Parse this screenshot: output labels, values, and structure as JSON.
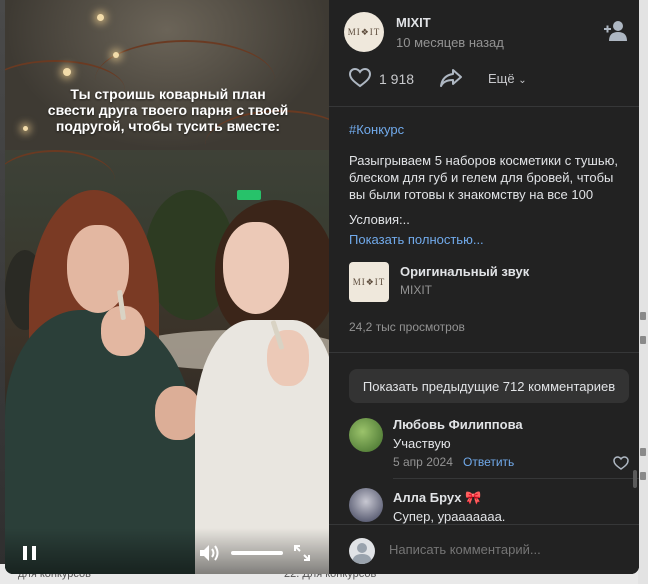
{
  "video": {
    "caption": "Ты строишь коварный план\nсвести друга твоего парня с твоей\nподругой, чтобы тусить вместе:",
    "icons": {
      "pause": "pause-icon",
      "volume": "volume-icon",
      "fullscreen": "fullscreen-icon"
    },
    "volume_level": 1.0
  },
  "post": {
    "author": "MIXIT",
    "logo_text": "MI❖IT",
    "date": "10 месяцев назад",
    "likes": "1 918",
    "more_label": "Ещё",
    "hashtag": "#Конкурс",
    "description": "Разыгрываем 5 наборов косметики с тушью, блеском для губ и гелем для бровей, чтобы вы были готовы к знакомству на все 100",
    "conditions": "Условия:..",
    "show_full": "Показать полностью...",
    "views": "24,2 тыс просмотров"
  },
  "sound": {
    "title": "Оригинальный звук",
    "artist": "MIXIT"
  },
  "comments": {
    "show_previous": "Показать предыдущие 712 комментариев",
    "items": [
      {
        "author": "Любовь Филиппова",
        "text": "Участвую",
        "date": "5 апр 2024",
        "reply": "Ответить"
      },
      {
        "author": "Алла Брух",
        "badge": "🎀",
        "text": "Супер, урааааааа."
      }
    ],
    "input_placeholder": "Написать комментарий..."
  },
  "backdrop": {
    "left_text": "для конкурсов",
    "right_text": "22. Для конкурсов"
  },
  "colors": {
    "accent": "#71aaeb",
    "panel_bg": "#222222",
    "text": "#e1e3e6",
    "muted": "#939393"
  }
}
